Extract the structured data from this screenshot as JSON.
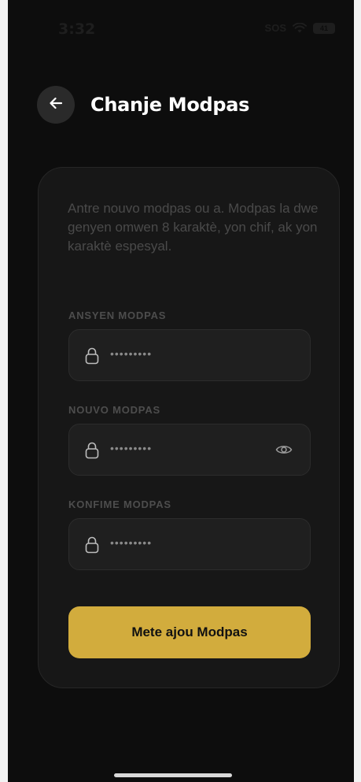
{
  "status_bar": {
    "time": "3:32",
    "sos": "SOS",
    "battery": "41"
  },
  "header": {
    "title": "Chanje Modpas",
    "back_icon": "arrow-left-icon"
  },
  "form": {
    "intro": "Antre nouvo modpas ou a. Modpas la dwe genyen omwen 8 karaktè, yon chif, ak yon karaktè espesyal.",
    "fields": [
      {
        "label": "ANSYEN MODPAS",
        "value": "•••••••••",
        "icon": "lock-icon"
      },
      {
        "label": "NOUVO MODPAS",
        "value": "•••••••••",
        "icon": "lock-icon",
        "toggle_icon": "eye-icon"
      },
      {
        "label": "KONFIME MODPAS",
        "value": "•••••••••",
        "icon": "lock-icon"
      }
    ],
    "submit_label": "Mete ajou Modpas"
  },
  "colors": {
    "background": "#0d0d0d",
    "card": "#171717",
    "field": "#1f1f1f",
    "accent": "#d2ac3d"
  }
}
